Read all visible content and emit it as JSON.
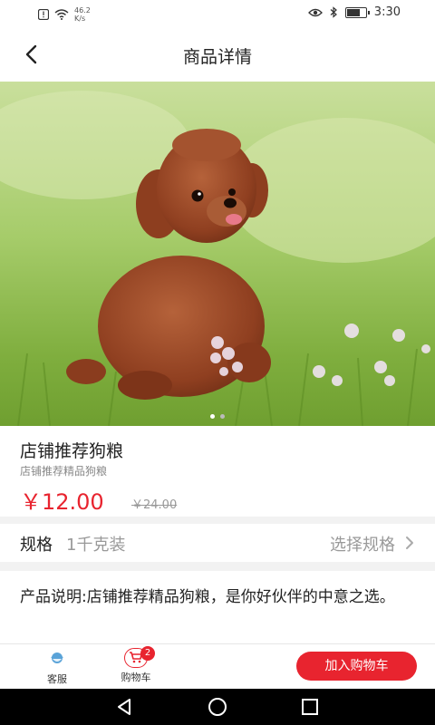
{
  "status_bar": {
    "net_speed_value": "46.2",
    "net_speed_unit": "K/s",
    "time": "3:30",
    "battery_level": 0.8
  },
  "header": {
    "title": "商品详情"
  },
  "product": {
    "name": "店铺推荐狗粮",
    "subtitle": "店铺推荐精品狗粮",
    "price": "￥12.00",
    "original_price": "￥24.00",
    "image_icon": "poodle-photo",
    "carousel": {
      "count": 2,
      "active_index": 0
    }
  },
  "spec": {
    "label": "规格",
    "value": "1千克装",
    "choose_label": "选择规格"
  },
  "description": {
    "text": "产品说明:店铺推荐精品狗粮，是你好伙伴的中意之选。"
  },
  "bottom_bar": {
    "service_label": "客服",
    "cart_label": "购物车",
    "cart_count": "2",
    "add_to_cart_label": "加入购物车"
  },
  "colors": {
    "accent": "#e8242f"
  }
}
